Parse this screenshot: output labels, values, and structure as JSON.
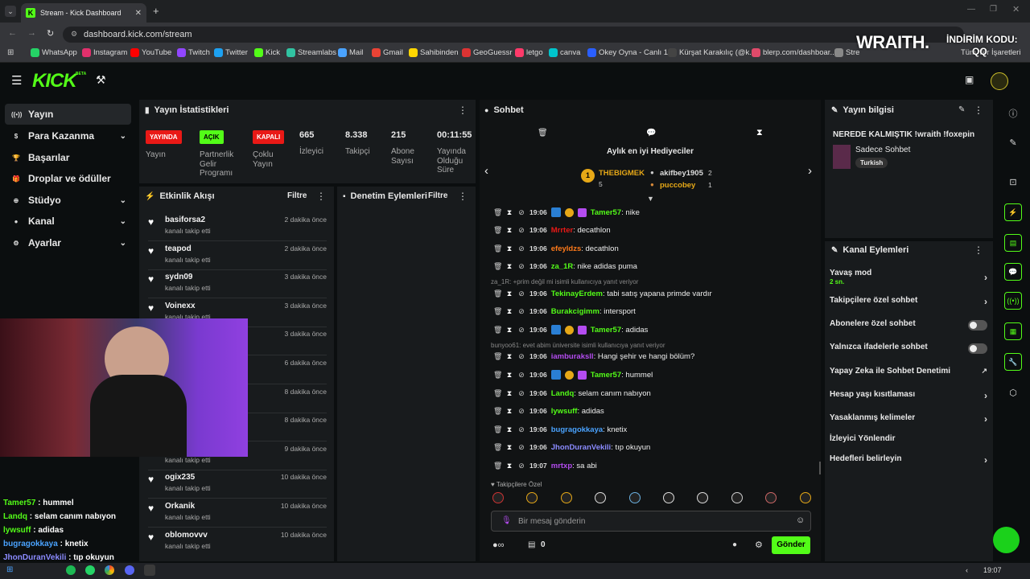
{
  "browser": {
    "tab_title": "Stream - Kick Dashboard",
    "url": "dashboard.kick.com/stream",
    "bookmarks": [
      "WhatsApp",
      "Instagram",
      "YouTube",
      "Twitch",
      "Twitter",
      "Kick",
      "Streamlabs",
      "Mail",
      "Gmail",
      "Sahibinden",
      "GeoGuessr",
      "letgo",
      "canva",
      "Okey Oyna - Canlı 1...",
      "Kürşat Karakılıç (@k...",
      "blerp.com/dashboar...",
      "Stre"
    ],
    "bookmarks_right": "Tüm Yer İşaretleri"
  },
  "overlay": {
    "sponsor": "WRAITH.",
    "discount_label": "İNDİRİM KODU:",
    "discount_code": "QQ"
  },
  "brand": {
    "logo": "KICK",
    "logo_sup": "BETA",
    "accent": "#53fc18"
  },
  "sidebar": {
    "items": [
      {
        "label": "Yayın",
        "icon": "broadcast-icon"
      },
      {
        "label": "Para Kazanma",
        "icon": "dollar-icon"
      },
      {
        "label": "Başarılar",
        "icon": "trophy-icon"
      },
      {
        "label": "Droplar ve ödüller",
        "icon": "gift-icon"
      },
      {
        "label": "Stüdyo",
        "icon": "globe-icon"
      },
      {
        "label": "Kanal",
        "icon": "user-icon"
      },
      {
        "label": "Ayarlar",
        "icon": "gear-icon"
      }
    ]
  },
  "stats": {
    "title": "Yayın İstatistikleri",
    "items": [
      {
        "badge": "YAYINDA",
        "label": "Yayın",
        "color": "#e91916"
      },
      {
        "badge": "AÇIK",
        "label": "Partnerlik Gelir Programı",
        "color": "#53fc18"
      },
      {
        "badge": "KAPALI",
        "label": "Çoklu Yayın",
        "color": "#e91916"
      },
      {
        "value": "665",
        "label": "İzleyici"
      },
      {
        "value": "8.338",
        "label": "Takipçi"
      },
      {
        "value": "215",
        "label": "Abone Sayısı"
      },
      {
        "value": "00:11:55",
        "label": "Yayında Olduğu Süre"
      }
    ]
  },
  "events": {
    "title": "Etkinlik Akışı",
    "filter": "Filtre",
    "items": [
      {
        "name": "basiforsa2",
        "action": "kanalı takip etti",
        "time": "2 dakika önce"
      },
      {
        "name": "teapod",
        "action": "kanalı takip etti",
        "time": "2 dakika önce"
      },
      {
        "name": "sydn09",
        "action": "kanalı takip etti",
        "time": "3 dakika önce"
      },
      {
        "name": "Voinexx",
        "action": "kanalı takip etti",
        "time": "3 dakika önce"
      },
      {
        "name": "",
        "action": "",
        "time": "3 dakika önce"
      },
      {
        "name": "",
        "action": "",
        "time": "6 dakika önce"
      },
      {
        "name": "",
        "action": "",
        "time": "8 dakika önce"
      },
      {
        "name": "",
        "action": "",
        "time": "8 dakika önce"
      },
      {
        "name": "",
        "action": "kanalı takip etti",
        "time": "9 dakika önce"
      },
      {
        "name": "ogix235",
        "action": "kanalı takip etti",
        "time": "10 dakika önce"
      },
      {
        "name": "Orkanik",
        "action": "kanalı takip etti",
        "time": "10 dakika önce"
      },
      {
        "name": "oblomovvv",
        "action": "kanalı takip etti",
        "time": "10 dakika önce"
      }
    ]
  },
  "moderation": {
    "title": "Denetim Eylemleri",
    "filter": "Filtre"
  },
  "chat": {
    "title": "Sohbet",
    "gifters_title": "Aylık en iyi Hediyeciler",
    "gifters": [
      {
        "name": "THEBIGMEK",
        "count": "5"
      },
      {
        "name": "akifbey1905",
        "count": "2"
      },
      {
        "name": "puccobey",
        "count": "1"
      }
    ],
    "messages": [
      {
        "time": "19:06",
        "user": "Tamer57",
        "color": "#53fc18",
        "text": ": nike",
        "badges": true
      },
      {
        "time": "19:06",
        "user": "Mrrter",
        "color": "#e91916",
        "text": ": decathlon"
      },
      {
        "time": "19:06",
        "user": "efeyldzs",
        "color": "#ff7a1a",
        "text": ": decathlon"
      },
      {
        "time": "19:06",
        "user": "za_1R",
        "color": "#53fc18",
        "text": ": nike adidas puma"
      },
      {
        "reply": "za_1R: +prim değil mi isimli kullanıcıya yanıt veriyor"
      },
      {
        "time": "19:06",
        "user": "TekinayErdem",
        "color": "#53fc18",
        "text": ": tabi satış yapana primde vardır"
      },
      {
        "time": "19:06",
        "user": "Burakcigimm",
        "color": "#53fc18",
        "text": ": intersport"
      },
      {
        "time": "19:06",
        "user": "Tamer57",
        "color": "#53fc18",
        "text": ": adidas",
        "badges": true
      },
      {
        "reply": "bunyoo61: evet abim üniversite isimli kullanıcıya yanıt veriyor"
      },
      {
        "time": "19:06",
        "user": "iamburaksll",
        "color": "#b44cf0",
        "text": ": Hangi şehir ve hangi bölüm?"
      },
      {
        "time": "19:06",
        "user": "Tamer57",
        "color": "#53fc18",
        "text": ": hummel",
        "badges": true
      },
      {
        "time": "19:06",
        "user": "Landq",
        "color": "#53fc18",
        "text": ": selam canım nabıyon"
      },
      {
        "time": "19:06",
        "user": "lywsuff",
        "color": "#53fc18",
        "text": ": adidas"
      },
      {
        "time": "19:06",
        "user": "bugragokkaya",
        "color": "#4aa3ff",
        "text": ": knetix"
      },
      {
        "time": "19:06",
        "user": "JhonDuranVekili",
        "color": "#8b8bff",
        "text": ": tıp okuyun"
      },
      {
        "time": "19:07",
        "user": "mrtxp",
        "color": "#b44cf0",
        "text": ": sa abi"
      }
    ],
    "followers_only": "Takipçilere Özel",
    "input_placeholder": "Bir mesaj gönderin",
    "points": "0",
    "send": "Gönder"
  },
  "stream_info": {
    "title_label": "Yayın bilgisi",
    "stream_title": "NEREDE KALMIŞTIK !wraith !foxepin",
    "category": "Sadece Sohbet",
    "tag": "Turkish"
  },
  "channel_actions": {
    "title": "Kanal Eylemleri",
    "slow_mode": "Yavaş mod",
    "slow_mode_value": "2 sn.",
    "items": [
      "Takipçilere özel sohbet",
      "Abonelere özel sohbet",
      "Yalnızca ifadelerle sohbet",
      "Yapay Zeka ile Sohbet Denetimi",
      "Hesap yaşı kısıtlaması",
      "Yasaklanmış kelimeler",
      "İzleyici Yönlendir",
      "Hedefleri belirleyin"
    ]
  },
  "overlay_chat": [
    {
      "user": "Tamer57",
      "text": " : hummel",
      "color": "#53fc18"
    },
    {
      "user": "Landq",
      "text": " : selam canım nabıyon",
      "color": "#53fc18"
    },
    {
      "user": "lywsuff",
      "text": " : adidas",
      "color": "#53fc18"
    },
    {
      "user": "bugragokkaya",
      "text": " : knetix",
      "color": "#4aa3ff"
    },
    {
      "user": "JhonDuranVekili",
      "text": " : tıp okuyun",
      "color": "#8b8bff"
    },
    {
      "user": "mrtxp",
      "text": " : sa abi",
      "color": "#b44cf0"
    }
  ],
  "taskbar": {
    "time": "19:07"
  }
}
